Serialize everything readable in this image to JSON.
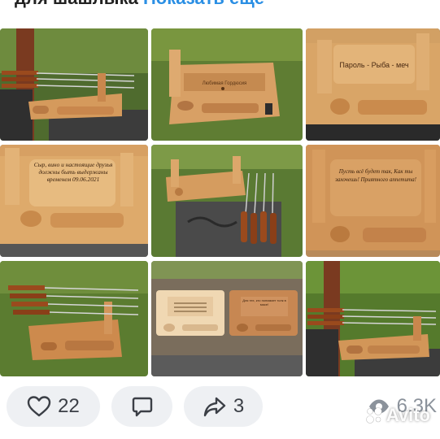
{
  "header": {
    "text_dark": "для шашлыка",
    "text_link": "Показать еще"
  },
  "gallery": {
    "photos": [
      {
        "id": "photo-1",
        "engraving": ""
      },
      {
        "id": "photo-2",
        "engraving": "Любимая Гордюсия"
      },
      {
        "id": "photo-3",
        "engraving": "Пароль - Рыба - меч"
      },
      {
        "id": "photo-4",
        "engraving": "Сыр, вино и настоящие друзья должны быть выдержаны временем 09.06.2021"
      },
      {
        "id": "photo-5",
        "engraving": ""
      },
      {
        "id": "photo-6",
        "engraving": "Пусть всё будет так, Как ты захочешь! Приятного аппетита!"
      },
      {
        "id": "photo-7",
        "engraving": ""
      },
      {
        "id": "photo-8",
        "engraving": "Для тех, кто понимает толк в мясе!"
      },
      {
        "id": "photo-9",
        "engraving": ""
      }
    ]
  },
  "actions": {
    "likes": "22",
    "shares": "3",
    "views": "6.3K"
  },
  "watermark": {
    "text": "Avito"
  },
  "colors": {
    "link": "#2b8fe4",
    "pill_bg": "#eef0f3",
    "icon": "#3b3f46",
    "views_text": "#8b929b"
  },
  "icons": [
    "heart-icon",
    "comment-icon",
    "share-icon",
    "eye-icon",
    "avito-logo-icon"
  ]
}
